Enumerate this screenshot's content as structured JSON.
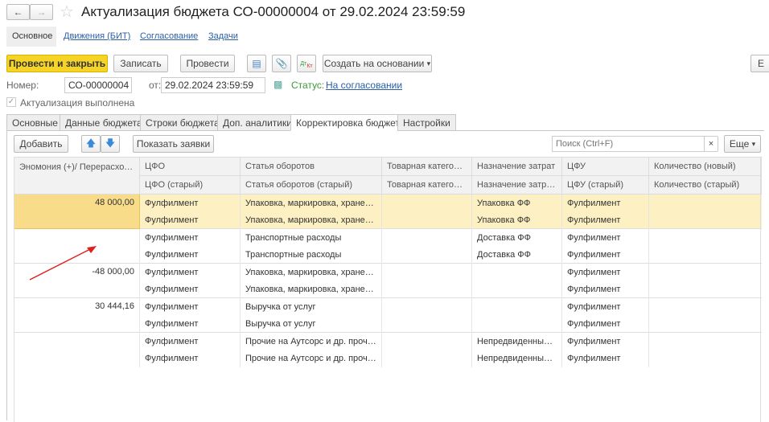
{
  "window": {
    "title": "Актуализация бюджета СО-00000004 от 29.02.2024 23:59:59"
  },
  "nav": {
    "tabs": [
      {
        "label": "Основное"
      },
      {
        "label": "Движения (БИТ)"
      },
      {
        "label": "Согласование"
      },
      {
        "label": "Задачи"
      }
    ]
  },
  "toolbar": {
    "post_close": "Провести и закрыть",
    "save": "Записать",
    "post": "Провести",
    "create_based": "Создать на основании",
    "more_cut": "Е"
  },
  "header": {
    "number_label": "Номер:",
    "number": "СО-00000004",
    "date_label": "от:",
    "date": "29.02.2024 23:59:59",
    "status_label": "Статус:",
    "status": "На согласовании",
    "checkbox_label": "Актуализация выполнена",
    "checkbox_checked": true
  },
  "tabs": [
    {
      "label": "Основные"
    },
    {
      "label": "Данные бюджета"
    },
    {
      "label": "Строки бюджета"
    },
    {
      "label": "Доп. аналитики"
    },
    {
      "label": "Корректировка бюджета",
      "active": true
    },
    {
      "label": "Настройки"
    }
  ],
  "table_toolbar": {
    "add": "Добавить",
    "show_requests": "Показать заявки",
    "search_placeholder": "Поиск (Ctrl+F)",
    "more": "Еще"
  },
  "table": {
    "headers1": [
      "Эномония (+)/ Перерасход (–)",
      "ЦФО",
      "Статья оборотов",
      "Товарная категория",
      "Назначение затрат",
      "ЦФУ",
      "Количество (новый)"
    ],
    "headers2": [
      "ЦФО (старый)",
      "Статья оборотов (старый)",
      "Товарная категория (старый)",
      "Назначение затрат (старый)",
      "ЦФУ (старый)",
      "Количество (старый)"
    ],
    "groups": [
      {
        "amount": "48 000,00",
        "highlight": true,
        "rows": [
          [
            "Фулфилмент",
            "Упаковка, маркировка, хранение",
            "",
            "Упаковка ФФ",
            "Фулфилмент",
            ""
          ],
          [
            "Фулфилмент",
            "Упаковка, маркировка, хранение",
            "",
            "Упаковка ФФ",
            "Фулфилмент",
            ""
          ]
        ]
      },
      {
        "amount": "",
        "rows": [
          [
            "Фулфилмент",
            "Транспортные расходы",
            "",
            "Доставка ФФ",
            "Фулфилмент",
            ""
          ],
          [
            "Фулфилмент",
            "Транспортные расходы",
            "",
            "Доставка ФФ",
            "Фулфилмент",
            ""
          ]
        ]
      },
      {
        "amount": "-48 000,00",
        "rows": [
          [
            "Фулфилмент",
            "Упаковка, маркировка, хранение",
            "",
            "",
            "Фулфилмент",
            ""
          ],
          [
            "Фулфилмент",
            "Упаковка, маркировка, хранение",
            "",
            "",
            "Фулфилмент",
            ""
          ]
        ]
      },
      {
        "amount": "30 444,16",
        "rows": [
          [
            "Фулфилмент",
            "Выручка от услуг",
            "",
            "",
            "Фулфилмент",
            ""
          ],
          [
            "Фулфилмент",
            "Выручка от услуг",
            "",
            "",
            "Фулфилмент",
            ""
          ]
        ]
      },
      {
        "amount": "",
        "rows": [
          [
            "Фулфилмент",
            "Прочие на Аутсорс и др. прочие",
            "",
            "Непредвиденные расходы",
            "Фулфилмент",
            ""
          ],
          [
            "Фулфилмент",
            "Прочие на Аутсорс и др. прочие",
            "",
            "Непредвиденные расходы",
            "Фулфилмент",
            ""
          ]
        ]
      }
    ]
  },
  "colors": {
    "primary_button": "#f5d327",
    "highlight_row": "#fdf1c3",
    "highlight_cell": "#f8dc8a",
    "annotation_arrow": "#e02020",
    "status_label": "#3a9a3a"
  }
}
